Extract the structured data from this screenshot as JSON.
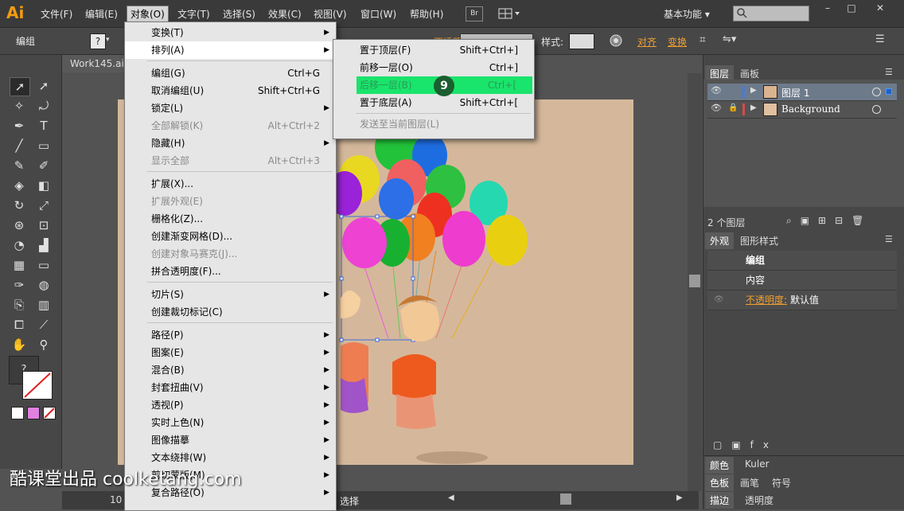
{
  "app": {
    "logo": "Ai",
    "brand_color": "#f39c12"
  },
  "menubar": {
    "items": [
      "文件(F)",
      "编辑(E)",
      "对象(O)",
      "文字(T)",
      "选择(S)",
      "效果(C)",
      "视图(V)",
      "窗口(W)",
      "帮助(H)"
    ],
    "active_index": 2,
    "br_label": "Br",
    "workspace": "基本功能",
    "window_controls": [
      "–",
      "□",
      "✕"
    ]
  },
  "controlbar": {
    "selection_label": "编组",
    "fill_icon": "?",
    "opacity_fragment": "不透明度",
    "style_label": "样式:",
    "align_link": "对齐",
    "transform_link": "变换"
  },
  "document": {
    "tab_title": "Work145.ai"
  },
  "object_menu": {
    "items": [
      {
        "label": "变换(T)",
        "shortcut": "",
        "submenu": true,
        "disabled": false
      },
      {
        "label": "排列(A)",
        "shortcut": "",
        "submenu": true,
        "disabled": false,
        "hover": true
      },
      {
        "sep": true
      },
      {
        "label": "编组(G)",
        "shortcut": "Ctrl+G",
        "submenu": false,
        "disabled": false
      },
      {
        "label": "取消编组(U)",
        "shortcut": "Shift+Ctrl+G",
        "submenu": false,
        "disabled": false
      },
      {
        "label": "锁定(L)",
        "shortcut": "",
        "submenu": true,
        "disabled": false
      },
      {
        "label": "全部解锁(K)",
        "shortcut": "Alt+Ctrl+2",
        "submenu": false,
        "disabled": true
      },
      {
        "label": "隐藏(H)",
        "shortcut": "",
        "submenu": true,
        "disabled": false
      },
      {
        "label": "显示全部",
        "shortcut": "Alt+Ctrl+3",
        "submenu": false,
        "disabled": true
      },
      {
        "sep": true
      },
      {
        "label": "扩展(X)...",
        "shortcut": "",
        "submenu": false,
        "disabled": false
      },
      {
        "label": "扩展外观(E)",
        "shortcut": "",
        "submenu": false,
        "disabled": true
      },
      {
        "label": "栅格化(Z)...",
        "shortcut": "",
        "submenu": false,
        "disabled": false
      },
      {
        "label": "创建渐变网格(D)...",
        "shortcut": "",
        "submenu": false,
        "disabled": false
      },
      {
        "label": "创建对象马赛克(J)...",
        "shortcut": "",
        "submenu": false,
        "disabled": true
      },
      {
        "label": "拼合透明度(F)...",
        "shortcut": "",
        "submenu": false,
        "disabled": false
      },
      {
        "sep": true
      },
      {
        "label": "切片(S)",
        "shortcut": "",
        "submenu": true,
        "disabled": false
      },
      {
        "label": "创建裁切标记(C)",
        "shortcut": "",
        "submenu": false,
        "disabled": false
      },
      {
        "sep": true
      },
      {
        "label": "路径(P)",
        "shortcut": "",
        "submenu": true,
        "disabled": false
      },
      {
        "label": "图案(E)",
        "shortcut": "",
        "submenu": true,
        "disabled": false
      },
      {
        "label": "混合(B)",
        "shortcut": "",
        "submenu": true,
        "disabled": false
      },
      {
        "label": "封套扭曲(V)",
        "shortcut": "",
        "submenu": true,
        "disabled": false
      },
      {
        "label": "透视(P)",
        "shortcut": "",
        "submenu": true,
        "disabled": false
      },
      {
        "label": "实时上色(N)",
        "shortcut": "",
        "submenu": true,
        "disabled": false
      },
      {
        "label": "图像描摹",
        "shortcut": "",
        "submenu": true,
        "disabled": false
      },
      {
        "label": "文本绕排(W)",
        "shortcut": "",
        "submenu": true,
        "disabled": false
      },
      {
        "label": "剪切蒙版(M)",
        "shortcut": "",
        "submenu": true,
        "disabled": false
      },
      {
        "label": "复合路径(O)",
        "shortcut": "",
        "submenu": true,
        "disabled": false
      }
    ]
  },
  "arrange_submenu": {
    "items": [
      {
        "label": "置于顶层(F)",
        "shortcut": "Shift+Ctrl+]",
        "disabled": false
      },
      {
        "label": "前移一层(O)",
        "shortcut": "Ctrl+]",
        "disabled": false
      },
      {
        "label": "后移一层(B)",
        "shortcut": "Ctrl+[",
        "disabled": false,
        "highlight": true
      },
      {
        "label": "置于底层(A)",
        "shortcut": "Shift+Ctrl+[",
        "disabled": false
      },
      {
        "sep": true
      },
      {
        "label": "发送至当前图层(L)",
        "shortcut": "",
        "disabled": true
      }
    ],
    "step_badge": "9",
    "highlight_color": "#19e46b"
  },
  "layers_panel": {
    "tabs": [
      "图层",
      "画板"
    ],
    "layers": [
      {
        "name": "图层 1",
        "color": "#4a7ad8",
        "locked": false
      },
      {
        "name": "Background",
        "color": "#d84a4a",
        "locked": true
      }
    ],
    "count_label": "2 个图层"
  },
  "appearance_panel": {
    "tabs": [
      "外观",
      "图形样式"
    ],
    "rows": [
      {
        "label": "编组"
      },
      {
        "label": "内容"
      },
      {
        "label": "不透明度:",
        "value": "默认值"
      }
    ]
  },
  "bottom_panels": [
    {
      "tabs": [
        "颜色",
        "Kuler"
      ]
    },
    {
      "tabs": [
        "色板",
        "画笔",
        "符号"
      ]
    },
    {
      "tabs": [
        "描边",
        "透明度"
      ]
    }
  ],
  "statusbar": {
    "tool_label": "选择",
    "zoom_fragment": "10"
  },
  "watermark": "酷课堂出品 coolketang.com"
}
